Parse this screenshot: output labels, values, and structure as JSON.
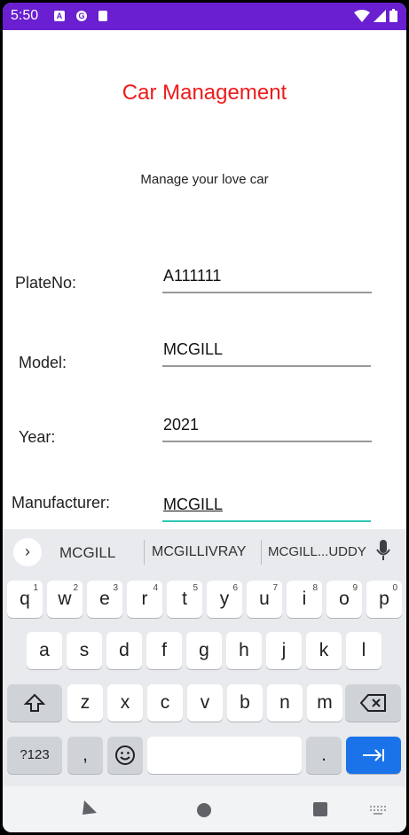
{
  "status_bar": {
    "time": "5:50",
    "notification_icons": [
      "A",
      "G",
      ""
    ]
  },
  "app": {
    "title": "Car Management",
    "subtitle": "Manage your love car",
    "fields": [
      {
        "label": "PlateNo:",
        "value": "A111111"
      },
      {
        "label": "Model:",
        "value": "MCGILL"
      },
      {
        "label": "Year:",
        "value": "2021"
      },
      {
        "label": "Manufacturer:",
        "value": "MCGILL"
      }
    ]
  },
  "keyboard": {
    "suggestions": [
      "MCGILL",
      "MCGILLIVRAY",
      "MCGILL...UDDY"
    ],
    "row1": [
      {
        "k": "q",
        "h": "1"
      },
      {
        "k": "w",
        "h": "2"
      },
      {
        "k": "e",
        "h": "3"
      },
      {
        "k": "r",
        "h": "4"
      },
      {
        "k": "t",
        "h": "5"
      },
      {
        "k": "y",
        "h": "6"
      },
      {
        "k": "u",
        "h": "7"
      },
      {
        "k": "i",
        "h": "8"
      },
      {
        "k": "o",
        "h": "9"
      },
      {
        "k": "p",
        "h": "0"
      }
    ],
    "row2": [
      "a",
      "s",
      "d",
      "f",
      "g",
      "h",
      "j",
      "k",
      "l"
    ],
    "row3": [
      "z",
      "x",
      "c",
      "v",
      "b",
      "n",
      "m"
    ],
    "symbols_label": "?123",
    "comma_label": ",",
    "period_label": ".",
    "accent_color": "#1a73e8"
  }
}
